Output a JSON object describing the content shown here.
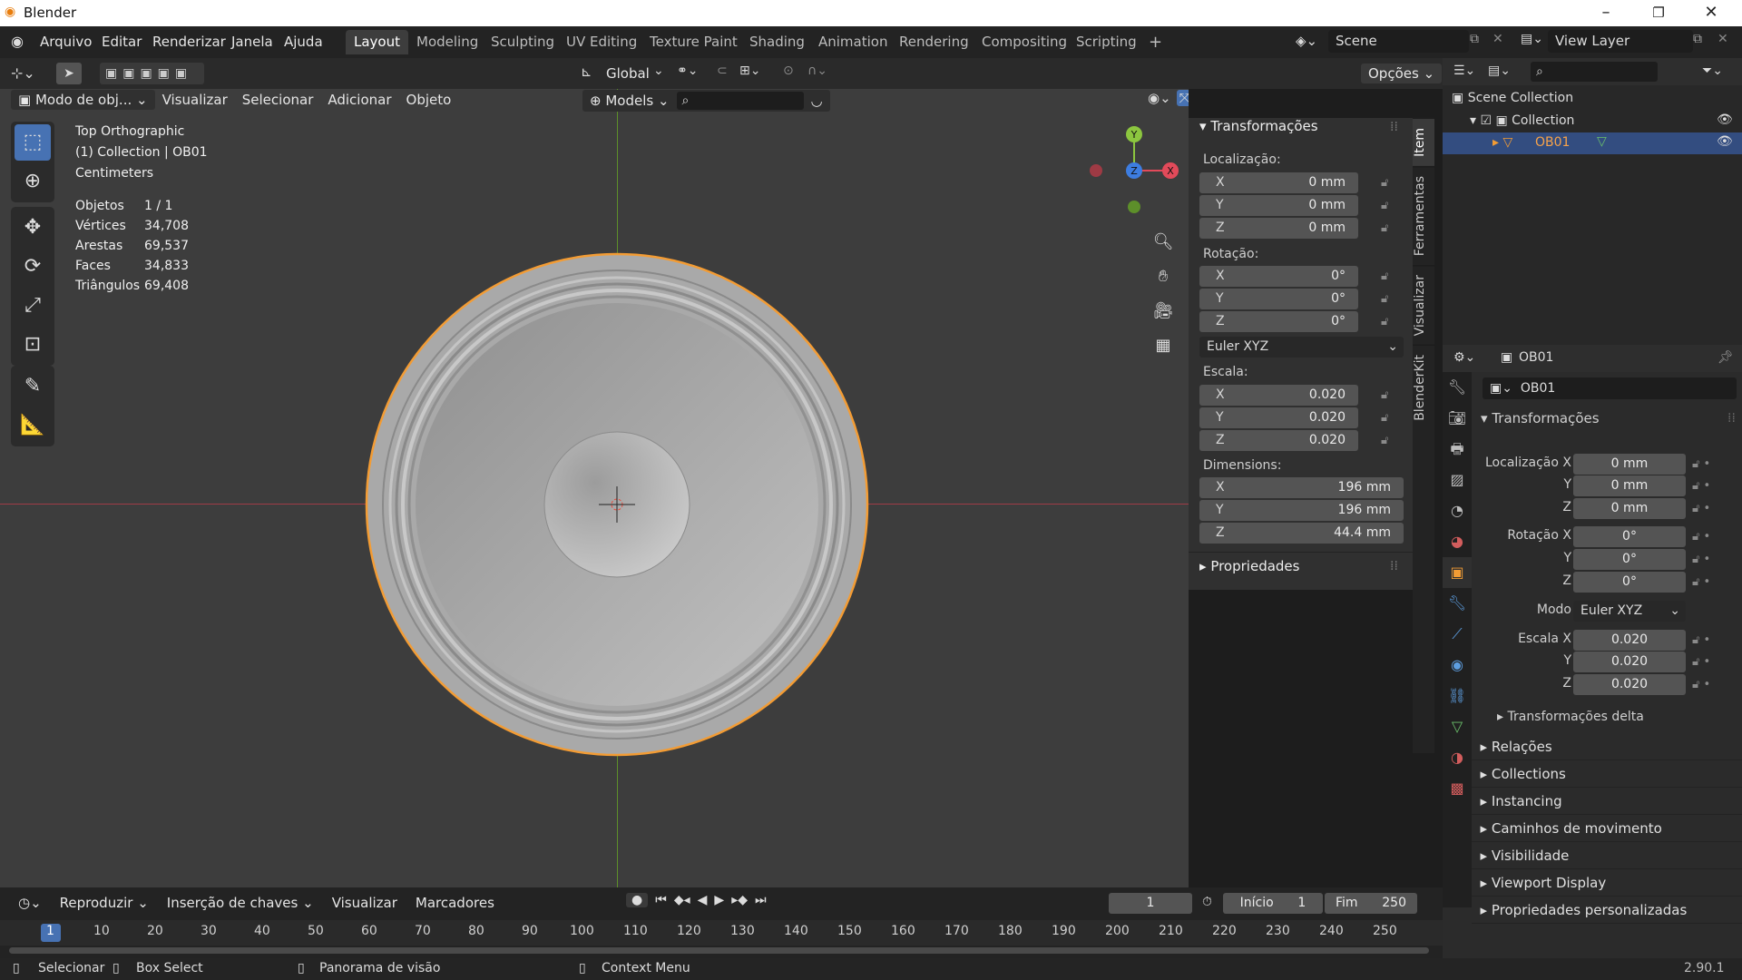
{
  "titlebar": {
    "title": "Blender"
  },
  "menus": [
    "Arquivo",
    "Editar",
    "Renderizar",
    "Janela",
    "Ajuda"
  ],
  "workspaces": [
    {
      "label": "Layout",
      "active": true
    },
    {
      "label": "Modeling"
    },
    {
      "label": "Sculpting"
    },
    {
      "label": "UV Editing"
    },
    {
      "label": "Texture Paint"
    },
    {
      "label": "Shading"
    },
    {
      "label": "Animation"
    },
    {
      "label": "Rendering"
    },
    {
      "label": "Compositing"
    },
    {
      "label": "Scripting"
    }
  ],
  "scene": {
    "name": "Scene",
    "view_layer": "View Layer"
  },
  "viewport_header": {
    "orientation": "Global",
    "options": "Opções",
    "mode": "Modo de obj...",
    "menus": [
      "Visualizar",
      "Selecionar",
      "Adicionar",
      "Objeto"
    ],
    "models": "Models"
  },
  "overlay_info": {
    "view": "Top Orthographic",
    "collection": "(1) Collection | OB01",
    "units": "Centimeters",
    "stats": [
      {
        "label": "Objetos",
        "value": "1 / 1"
      },
      {
        "label": "Vértices",
        "value": "34,708"
      },
      {
        "label": "Arestas",
        "value": "69,537"
      },
      {
        "label": "Faces",
        "value": "34,833"
      },
      {
        "label": "Triângulos",
        "value": "69,408"
      }
    ]
  },
  "npanel": {
    "header": "Transformações",
    "loc_label": "Localização:",
    "location": [
      "0 mm",
      "0 mm",
      "0 mm"
    ],
    "rot_label": "Rotação:",
    "rotation": [
      "0°",
      "0°",
      "0°"
    ],
    "rot_mode": "Euler XYZ",
    "scale_label": "Escala:",
    "scale": [
      "0.020",
      "0.020",
      "0.020"
    ],
    "dim_label": "Dimensions:",
    "dimensions": [
      "196 mm",
      "196 mm",
      "44.4 mm"
    ],
    "properties": "Propriedades",
    "tabs": [
      "Item",
      "Ferramentas",
      "Visualizar",
      "BlenderKit"
    ]
  },
  "outliner": {
    "scene_collection": "Scene Collection",
    "collection": "Collection",
    "object": "OB01"
  },
  "properties": {
    "object_name": "OB01",
    "data_name": "OB01",
    "section": "Transformações",
    "loc_label": "Localização X",
    "location": [
      "0 mm",
      "0 mm",
      "0 mm"
    ],
    "rot_label": "Rotação X",
    "rotation": [
      "0°",
      "0°",
      "0°"
    ],
    "mode_label": "Modo",
    "mode": "Euler XYZ",
    "scale_label": "Escala X",
    "scale": [
      "0.020",
      "0.020",
      "0.020"
    ],
    "delta": "Transformações delta",
    "sections": [
      "Relações",
      "Collections",
      "Instancing",
      "Caminhos de movimento",
      "Visibilidade",
      "Viewport Display",
      "Propriedades personalizadas"
    ]
  },
  "timeline": {
    "menus": [
      "Reproduzir",
      "Inserção de chaves",
      "Visualizar",
      "Marcadores"
    ],
    "current_frame": "1",
    "start_label": "Início",
    "start": "1",
    "end_label": "Fim",
    "end": "250",
    "ruler": [
      "1",
      "10",
      "20",
      "30",
      "40",
      "50",
      "60",
      "70",
      "80",
      "90",
      "100",
      "110",
      "120",
      "130",
      "140",
      "150",
      "160",
      "170",
      "180",
      "190",
      "200",
      "210",
      "220",
      "230",
      "240",
      "250"
    ]
  },
  "statusbar": {
    "items": [
      "Selecionar",
      "Box Select",
      "Panorama de visão",
      "Context Menu"
    ],
    "version": "2.90.1"
  },
  "axis_labels": {
    "x": "X",
    "y": "Y",
    "z": "Z"
  },
  "colors": {
    "accent": "#4772b3",
    "selected_outline": "#f39c34",
    "x_axis": "#e24a5a",
    "y_axis": "#8cc63f",
    "z_axis": "#3d7de0"
  }
}
